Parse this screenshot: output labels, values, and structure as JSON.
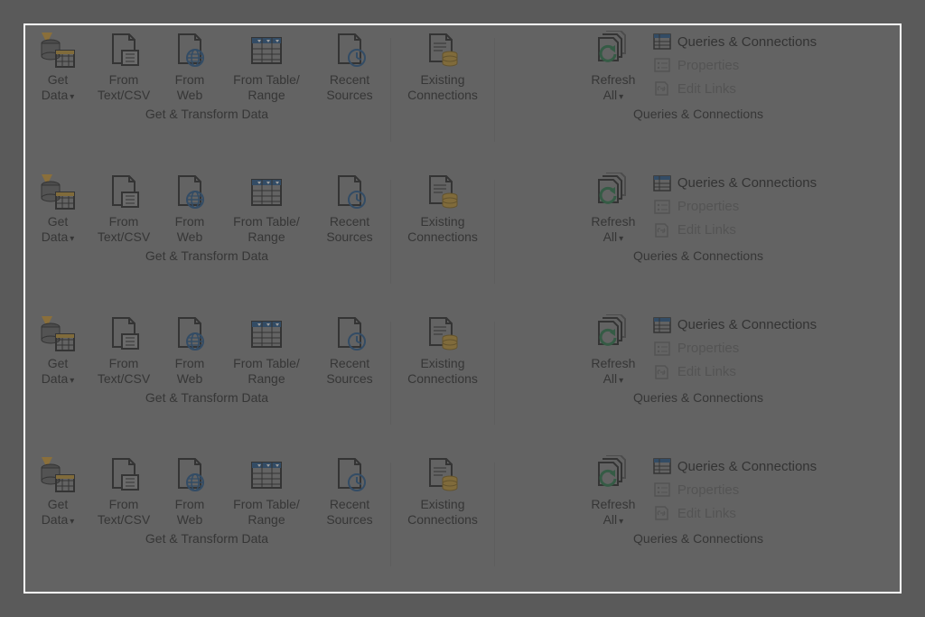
{
  "row_count": 4,
  "groups": {
    "get_transform": {
      "title": "Get & Transform Data",
      "buttons": {
        "get_data": "Get\nData",
        "from_text_csv": "From\nText/CSV",
        "from_web": "From\nWeb",
        "from_table_range": "From Table/\nRange",
        "recent_sources": "Recent\nSources"
      }
    },
    "existing_connections": {
      "button": "Existing\nConnections"
    },
    "queries_connections": {
      "title": "Queries & Connections",
      "refresh_all": "Refresh\nAll",
      "items": {
        "queries_connections": "Queries & Connections",
        "properties": "Properties",
        "edit_links": "Edit Links"
      }
    }
  },
  "dropdown_glyph": "▾"
}
